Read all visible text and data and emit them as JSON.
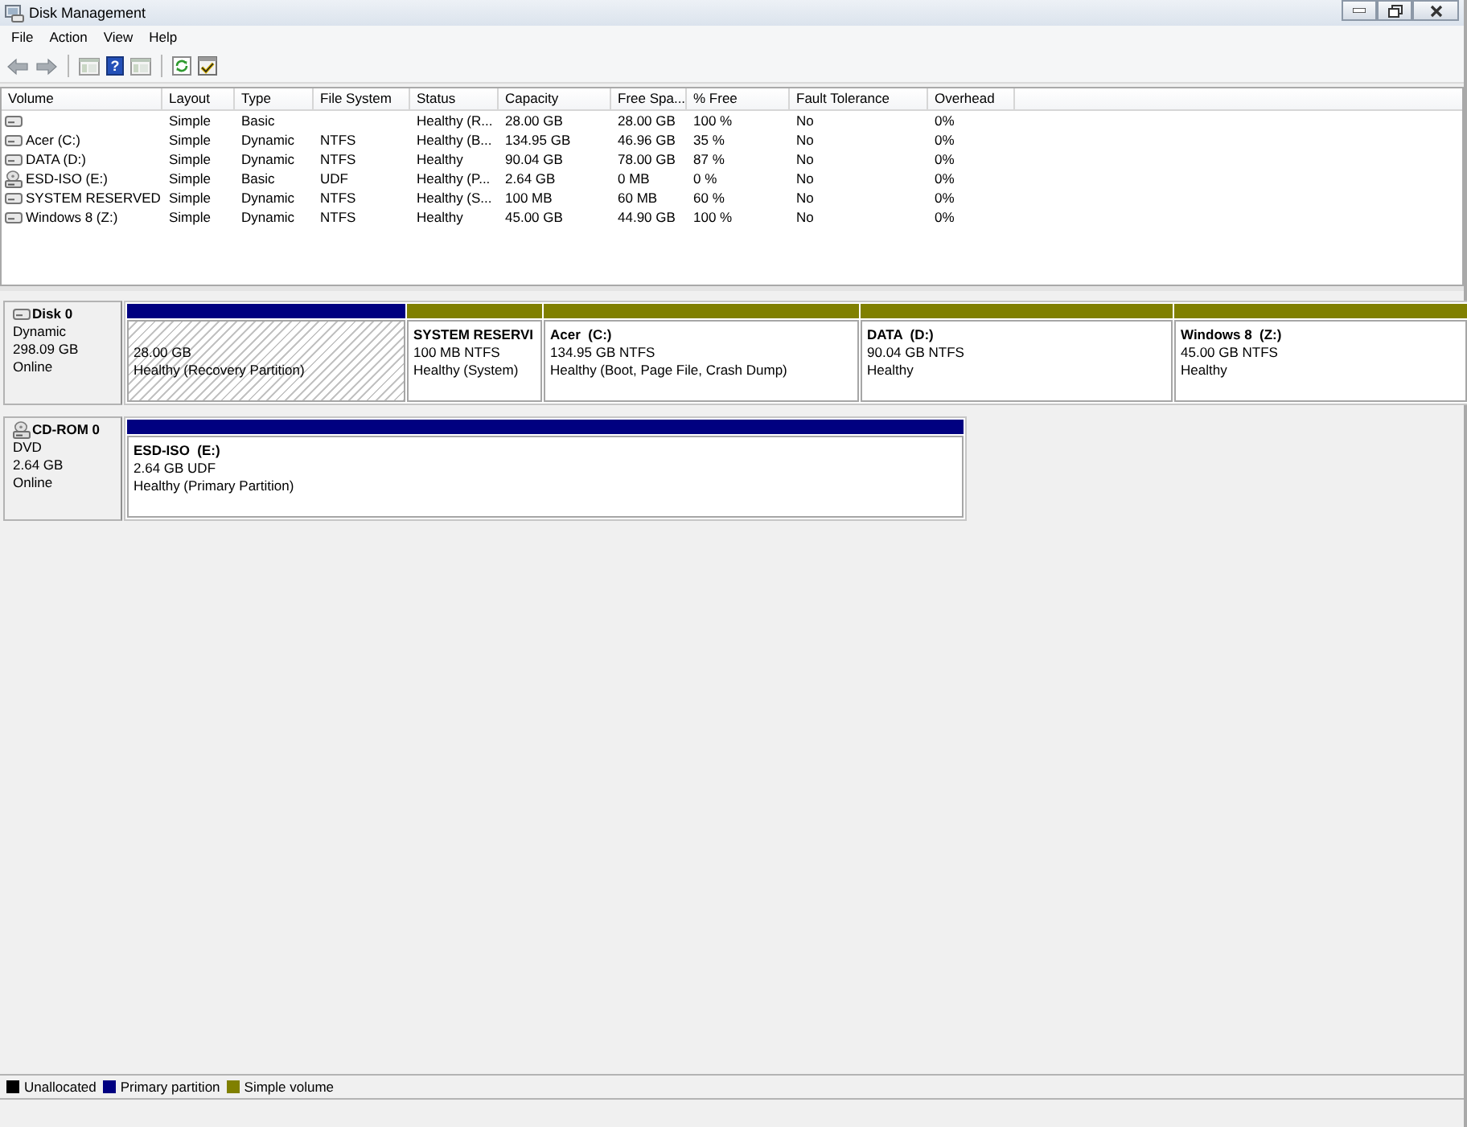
{
  "window": {
    "title": "Disk Management"
  },
  "menu": [
    "File",
    "Action",
    "View",
    "Help"
  ],
  "toolbar_groups": [
    {
      "buttons": [
        {
          "kind": "back",
          "disabled": true
        },
        {
          "kind": "forward",
          "disabled": true
        }
      ]
    },
    {
      "buttons": [
        {
          "kind": "console",
          "disabled": false
        },
        {
          "kind": "help",
          "glyph": "?",
          "disabled": false
        },
        {
          "kind": "pane",
          "disabled": false
        }
      ]
    },
    {
      "buttons": [
        {
          "kind": "refresh",
          "disabled": false
        },
        {
          "kind": "properties",
          "disabled": false
        }
      ]
    }
  ],
  "volume_list": {
    "columns": [
      "Volume",
      "Layout",
      "Type",
      "File System",
      "Status",
      "Capacity",
      "Free Spa...",
      "% Free",
      "Fault Tolerance",
      "Overhead"
    ],
    "rows": [
      {
        "kind": "disk",
        "layout": "Simple",
        "type": "Basic",
        "status": "Healthy (R...",
        "capacity": "28.00 GB",
        "free_space": "28.00 GB",
        "percent_free": "100 %",
        "fault_tolerance": "No",
        "overhead": "0%"
      },
      {
        "kind": "disk",
        "volume": "Acer (C:)",
        "layout": "Simple",
        "type": "Dynamic",
        "file_system": "NTFS",
        "status": "Healthy (B...",
        "capacity": "134.95 GB",
        "free_space": "46.96 GB",
        "percent_free": "35 %",
        "fault_tolerance": "No",
        "overhead": "0%"
      },
      {
        "kind": "disk",
        "volume": "DATA (D:)",
        "layout": "Simple",
        "type": "Dynamic",
        "file_system": "NTFS",
        "status": "Healthy",
        "capacity": "90.04 GB",
        "free_space": "78.00 GB",
        "percent_free": "87 %",
        "fault_tolerance": "No",
        "overhead": "0%"
      },
      {
        "kind": "cd",
        "volume": "ESD-ISO (E:)",
        "layout": "Simple",
        "type": "Basic",
        "file_system": "UDF",
        "status": "Healthy (P...",
        "capacity": "2.64 GB",
        "free_space": "0 MB",
        "percent_free": "0 %",
        "fault_tolerance": "No",
        "overhead": "0%"
      },
      {
        "kind": "disk",
        "volume": "SYSTEM RESERVED",
        "layout": "Simple",
        "type": "Dynamic",
        "file_system": "NTFS",
        "status": "Healthy (S...",
        "capacity": "100 MB",
        "free_space": "60 MB",
        "percent_free": "60 %",
        "fault_tolerance": "No",
        "overhead": "0%"
      },
      {
        "kind": "disk",
        "volume": "Windows 8 (Z:)",
        "layout": "Simple",
        "type": "Dynamic",
        "file_system": "NTFS",
        "status": "Healthy",
        "capacity": "45.00 GB",
        "free_space": "44.90 GB",
        "percent_free": "100 %",
        "fault_tolerance": "No",
        "overhead": "0%"
      }
    ]
  },
  "disks": [
    {
      "kind": "disk",
      "name": "Disk 0",
      "type": "Dynamic",
      "size": "298.09 GB",
      "state": "Online",
      "partitions": [
        {
          "capacity": "28.00 GB",
          "status": "Healthy (Recovery Partition)",
          "color": "#000080",
          "selected": true
        },
        {
          "name": "SYSTEM RESERVI",
          "capacity": "100 MB NTFS",
          "status": "Healthy (System)",
          "color": "#808000",
          "selected": false
        },
        {
          "name": "Acer  (C:)",
          "capacity": "134.95 GB NTFS",
          "status": "Healthy (Boot, Page File, Crash Dump)",
          "color": "#808000",
          "selected": false
        },
        {
          "name": "DATA  (D:)",
          "capacity": "90.04 GB NTFS",
          "status": "Healthy",
          "color": "#808000",
          "selected": false
        },
        {
          "name": "Windows 8  (Z:)",
          "capacity": "45.00 GB NTFS",
          "status": "Healthy",
          "color": "#808000",
          "selected": false
        }
      ]
    },
    {
      "kind": "cd",
      "name": "CD-ROM 0",
      "type": "DVD",
      "size": "2.64 GB",
      "state": "Online",
      "partitions": [
        {
          "name": "ESD-ISO  (E:)",
          "capacity": "2.64 GB UDF",
          "status": "Healthy (Primary Partition)",
          "color": "#000080",
          "selected": false
        }
      ]
    }
  ],
  "legend": [
    {
      "label": "Unallocated",
      "color": "#000000"
    },
    {
      "label": "Primary partition",
      "color": "#000080"
    },
    {
      "label": "Simple volume",
      "color": "#808000"
    }
  ]
}
